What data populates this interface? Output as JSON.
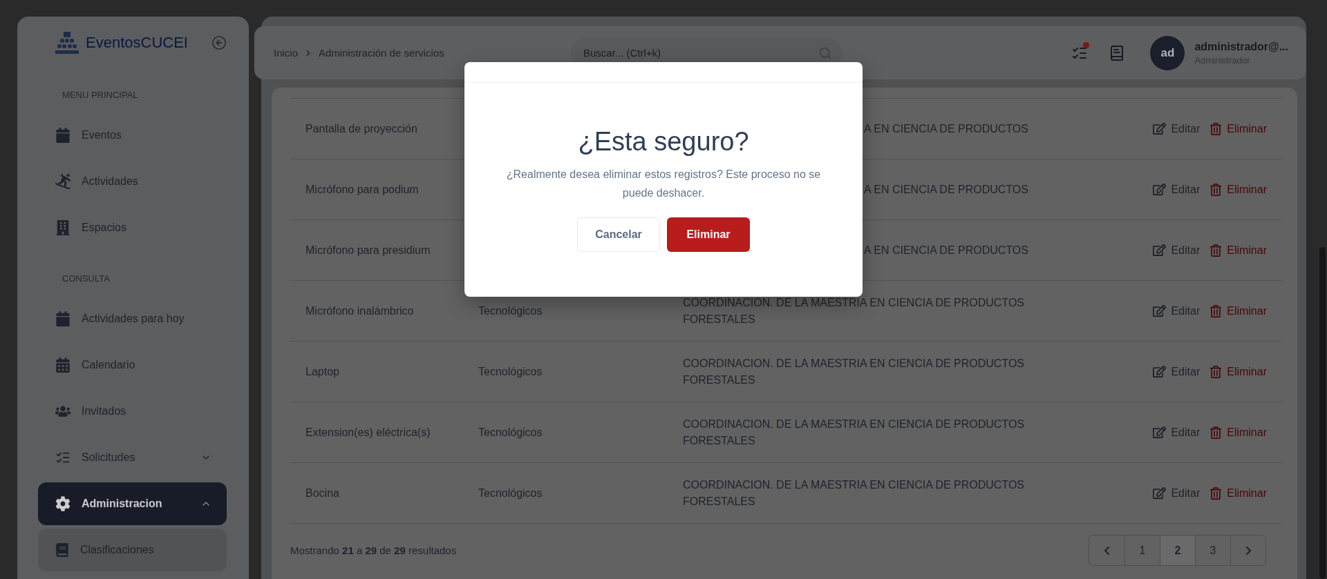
{
  "sidebar": {
    "brand": "EventosCUCEI",
    "sections": [
      {
        "title": "MENU PRINCIPAL",
        "items": [
          {
            "label": "Eventos",
            "selected": false
          },
          {
            "label": "Actividades",
            "selected": false
          },
          {
            "label": "Espacios",
            "selected": false
          }
        ]
      },
      {
        "title": "CONSULTA",
        "items": [
          {
            "label": "Actividades para hoy",
            "selected": false
          },
          {
            "label": "Calendario",
            "selected": false
          },
          {
            "label": "Invitados",
            "selected": false
          },
          {
            "label": "Solicitudes",
            "selected": false,
            "expanded": false
          },
          {
            "label": "Administracion",
            "selected": true,
            "expanded": true,
            "children": [
              {
                "label": "Clasificaciones",
                "selected": false
              }
            ]
          }
        ]
      }
    ]
  },
  "breadcrumb": [
    "Inicio",
    "Administración de servicios"
  ],
  "search": {
    "placeholder": "Buscar... (Ctrl+k)"
  },
  "notifications": {
    "unread": true
  },
  "user": {
    "initials": "ad",
    "name": "administrador@...",
    "role": "Administrador"
  },
  "table": {
    "rows": [
      {
        "name": "Pantalla de proyección",
        "dependency": "A EN CIENCIA DE PRODUCTOS",
        "kind": "partial",
        "edit": "Editar",
        "delete": "Eliminar"
      },
      {
        "name": "Micrófono para podium",
        "dependency": "A EN CIENCIA DE PRODUCTOS",
        "kind": "partial",
        "edit": "Editar",
        "delete": "Eliminar"
      },
      {
        "name": "Micrófono para presidium",
        "dependency": "A EN CIENCIA DE PRODUCTOS",
        "kind": "partial",
        "edit": "Editar",
        "delete": "Eliminar"
      },
      {
        "name": "Micrófono inalámbrico",
        "category": "Tecnológicos",
        "dependency": "COORDINACION. DE LA MAESTRIA EN CIENCIA DE PRODUCTOS FORESTALES",
        "kind": "full",
        "edit": "Editar",
        "delete": "Eliminar"
      },
      {
        "name": "Laptop",
        "category": "Tecnológicos",
        "dependency": "COORDINACION. DE LA MAESTRIA EN CIENCIA DE PRODUCTOS FORESTALES",
        "kind": "full",
        "edit": "Editar",
        "delete": "Eliminar"
      },
      {
        "name": "Extension(es) eléctrica(s)",
        "category": "Tecnológicos",
        "dependency": "COORDINACION. DE LA MAESTRIA EN CIENCIA DE PRODUCTOS FORESTALES",
        "kind": "full",
        "edit": "Editar",
        "delete": "Eliminar"
      },
      {
        "name": "Bocina",
        "category": "Tecnológicos",
        "dependency": "COORDINACION. DE LA MAESTRIA EN CIENCIA DE PRODUCTOS FORESTALES",
        "kind": "full",
        "edit": "Editar",
        "delete": "Eliminar"
      }
    ]
  },
  "footer": {
    "summary": "Mostrando **21** a **29** de **29** resultados",
    "pages": [
      {
        "label": "1",
        "selected": false
      },
      {
        "label": "2",
        "selected": true
      },
      {
        "label": "3",
        "selected": false
      }
    ]
  },
  "dialog": {
    "title": "¿Esta seguro?",
    "message": "¿Realmente desea eliminar estos registros? Este proceso no se puede deshacer.",
    "cancel": "Cancelar",
    "confirm": "Eliminar"
  }
}
